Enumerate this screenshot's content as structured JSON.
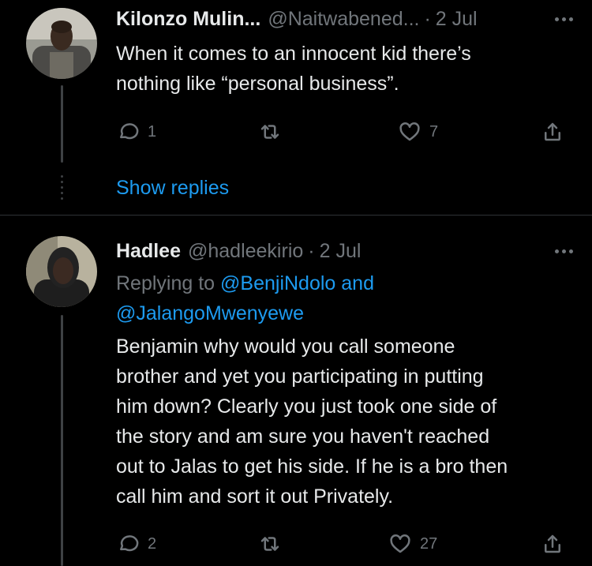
{
  "tweet1": {
    "name": "Kilonzo Mulin...",
    "handle": "@Naitwabened...",
    "separator": "·",
    "time": "2 Jul",
    "text_line1": "When it comes to an innocent kid there’s",
    "text_line2": "nothing like “personal business”.",
    "reply_count": "1",
    "retweet_count": "",
    "like_count": "7",
    "show_replies": "Show replies"
  },
  "tweet2": {
    "name": "Hadlee",
    "handle": "@hadleekirio",
    "separator": "·",
    "time": "2 Jul",
    "replying_prefix": "Replying to",
    "replying_user1": "@BenjiNdolo",
    "replying_and": "and",
    "replying_user2": "@JalangoMwenyewe",
    "body_lines": [
      "Benjamin why would you call someone",
      "brother and yet you participating in putting",
      "him down? Clearly you just took one side of",
      "the story and am sure you haven't reached",
      "out to Jalas to get his side. If he is a bro then",
      "call him and sort it out Privately."
    ],
    "reply_count": "2",
    "retweet_count": "",
    "like_count": "27"
  },
  "colors": {
    "background": "#000000",
    "text": "#e7e9ea",
    "muted": "#71767b",
    "link": "#1d9bf0",
    "divider": "#2f3336"
  },
  "icons": [
    "reply-icon",
    "retweet-icon",
    "like-icon",
    "share-icon",
    "more-icon"
  ]
}
